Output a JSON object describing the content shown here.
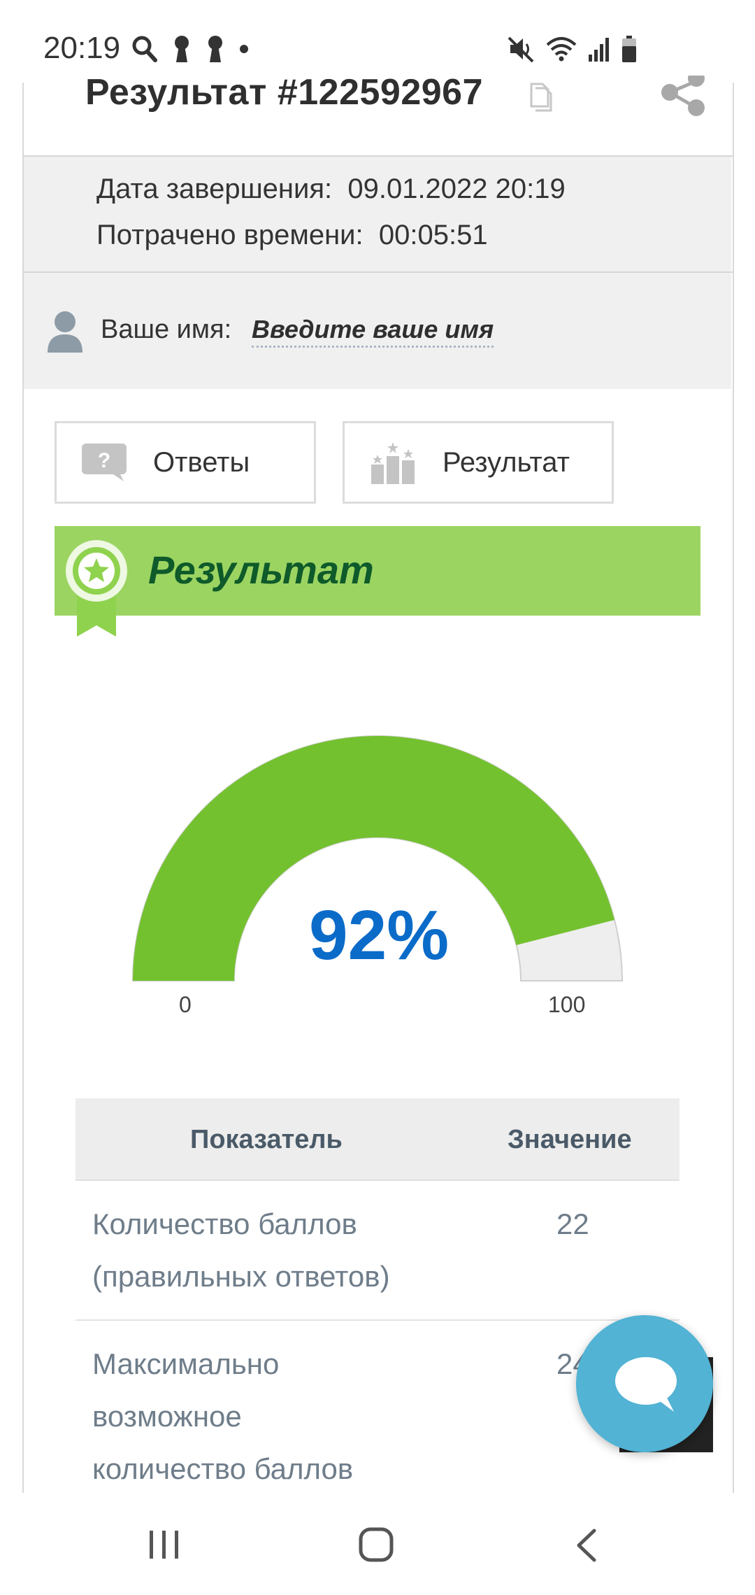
{
  "status_bar": {
    "time": "20:19",
    "left_icons": [
      "search-icon",
      "keyhole-icon",
      "keyhole-icon",
      "dot-icon"
    ],
    "right_icons": [
      "mute-icon",
      "wifi-icon",
      "signal-icon",
      "battery-icon"
    ]
  },
  "header": {
    "title": "Результат #122592967"
  },
  "info": {
    "completion_label": "Дата завершения:",
    "completion_value": "09.01.2022 20:19",
    "time_spent_label": "Потрачено времени:",
    "time_spent_value": "00:05:51"
  },
  "user": {
    "name_label": "Ваше имя:",
    "name_placeholder": "Введите ваше имя"
  },
  "tabs": [
    {
      "label": "Ответы"
    },
    {
      "label": "Результат"
    }
  ],
  "result_section": {
    "title": "Результат"
  },
  "gauge": {
    "value_text": "92%",
    "value_fraction": 0.92,
    "min_label": "0",
    "max_label": "100",
    "fill_color": "#74c12f",
    "track_color": "#eeeeee"
  },
  "table": {
    "headers": [
      "Показатель",
      "Значение"
    ],
    "rows": [
      {
        "indicator_lines": [
          "Количество баллов",
          "(правильных ответов)"
        ],
        "value": "22"
      },
      {
        "indicator_lines": [
          "Максимально",
          "возможное",
          "количество баллов"
        ],
        "value": "24"
      }
    ]
  },
  "colors": {
    "banner": "#9bd461",
    "banner_text": "#0e5a2a",
    "gauge_value": "#0b6bc9",
    "fab": "#52b3d4"
  }
}
